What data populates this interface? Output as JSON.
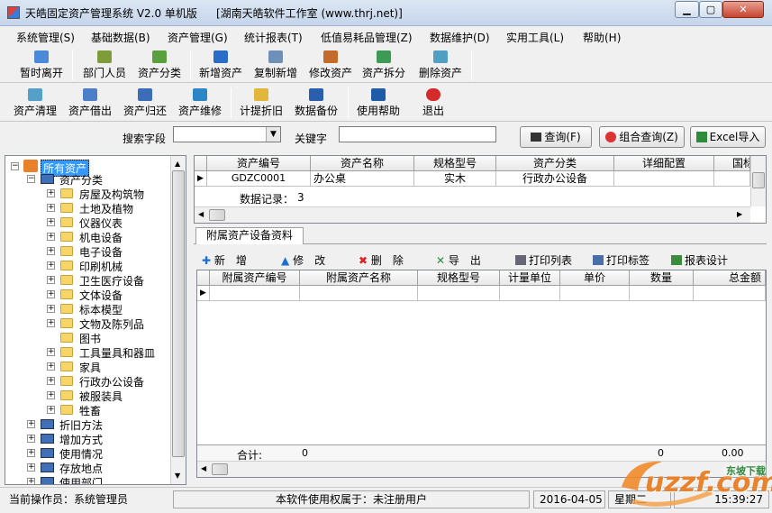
{
  "window": {
    "title": "天皓固定资产管理系统 V2.0 单机版",
    "title_extra": "[湖南天皓软件工作室 (www.thrj.net)]",
    "min_label": "▁",
    "max_label": "▢",
    "close_label": "✕"
  },
  "menu": [
    "系统管理(S)",
    "基础数据(B)",
    "资产管理(G)",
    "统计报表(T)",
    "低值易耗品管理(Z)",
    "数据维护(D)",
    "实用工具(L)",
    "帮助(H)"
  ],
  "toolbar1": [
    "暂时离开",
    "部门人员",
    "资产分类",
    "新增资产",
    "复制新增",
    "修改资产",
    "资产拆分",
    "删除资产"
  ],
  "toolbar2": [
    "资产清理",
    "资产借出",
    "资产归还",
    "资产维修",
    "计提折旧",
    "数据备份",
    "使用帮助",
    "退出"
  ],
  "search": {
    "field_label": "搜索字段",
    "field_value": "",
    "keyword_label": "关键字",
    "keyword_value": "",
    "query_button": "查询(F)",
    "combo_button": "组合查询(Z)",
    "excel_button": "Excel导入"
  },
  "tree": {
    "root": "所有资产",
    "category": "资产分类",
    "children": [
      "房屋及构筑物",
      "土地及植物",
      "仪器仪表",
      "机电设备",
      "电子设备",
      "印刷机械",
      "卫生医疗设备",
      "文体设备",
      "标本模型",
      "文物及陈列品",
      "图书",
      "工具量具和器皿",
      "家具",
      "行政办公设备",
      "被服装具",
      "牲畜"
    ],
    "others": [
      "折旧方法",
      "增加方式",
      "使用情况",
      "存放地点",
      "使用部门"
    ]
  },
  "main_grid": {
    "columns": [
      "资产编号",
      "资产名称",
      "规格型号",
      "资产分类",
      "详细配置",
      "国标"
    ],
    "rows": [
      [
        "GDZC0001",
        "办公桌",
        "实木",
        "行政办公设备",
        "",
        ""
      ]
    ],
    "footer_label": "数据记录：",
    "footer_value": "3"
  },
  "sub": {
    "tab": "附属资产设备资料",
    "actions": [
      "新　增",
      "修　改",
      "删　除",
      "导　出",
      "打印列表",
      "打印标签",
      "报表设计"
    ],
    "columns": [
      "附属资产编号",
      "附属资产名称",
      "规格型号",
      "计量单位",
      "单价",
      "数量",
      "总金额"
    ],
    "total_label": "合计:",
    "total_left": "0",
    "total_qty": "0",
    "total_amount": "0.00"
  },
  "status": {
    "operator": "当前操作员：系统管理员",
    "license": "本软件使用权属于：未注册用户",
    "date": "2016-04-05",
    "weekday": "星期二",
    "time": "15:39:27"
  },
  "watermark": {
    "brand": "uzzf.com",
    "sub": "东坡下载"
  },
  "colors": {
    "selection": "#3399ff",
    "accent": "#0a57a6",
    "watermark": "#e9822d"
  }
}
